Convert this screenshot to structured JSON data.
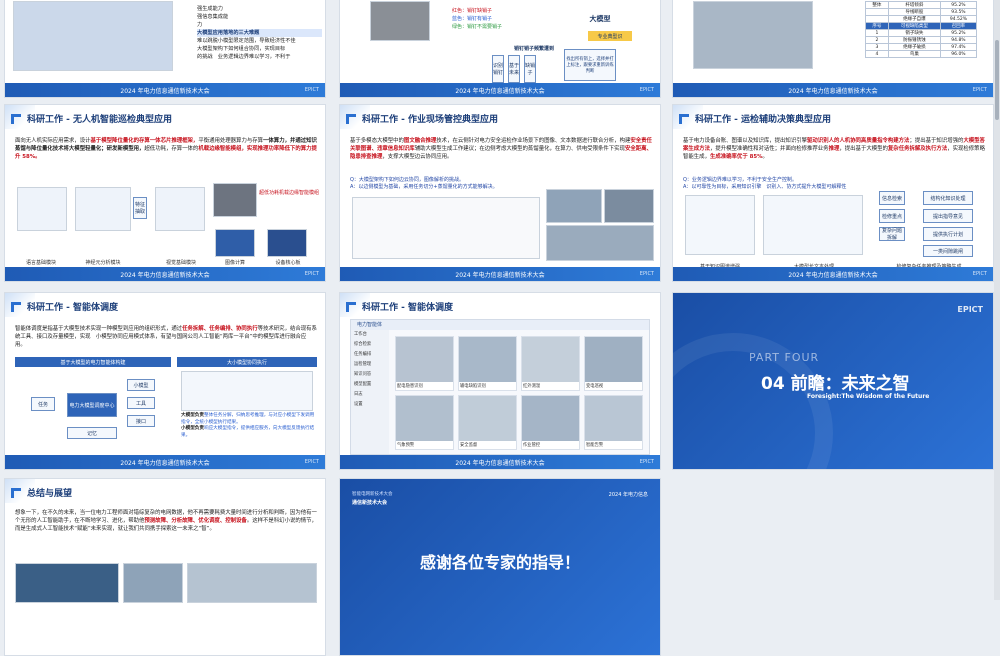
{
  "footer_text": "2024 年电力信息通信新技术大会",
  "footer_logo": "EPICT",
  "s1": {
    "items": [
      "强生成能力",
      "强信息集成能",
      "力",
      "大模型应用落地的三大难题",
      "难以跳脱小模型限定范围，导致经济性不佳",
      "大模型架构下如何组合协同，实现目标",
      "的挑战　业务逻辑边界难以学习，不利于"
    ]
  },
  "s2": {
    "labels": [
      "红色：销钉缺销子",
      "蓝色：销钉有销子",
      "绿色：销钉不需要销子",
      "大模型",
      "销钉销子频繁遭到",
      "识别销钉",
      "基于未来",
      "缺销子",
      "多次训练上：选择大模型（前期是从少数样本总结经验）",
      "找出所有销上，选择并打上标注，跟要求重新训练判断",
      "销钉部分"
    ],
    "right": [
      "大模型",
      "专业典型识"
    ]
  },
  "s3": {
    "rows": [
      [
        "整体",
        "杆塔倾斜",
        "95.2%"
      ],
      [
        "",
        "导线断股",
        "93.5%"
      ],
      [
        "",
        "绝缘子自爆",
        "94.52%"
      ],
      [
        "序号",
        "可视缺陷类型",
        "召回率"
      ],
      [
        "1",
        "销子缺失",
        "95.2%"
      ],
      [
        "2",
        "防振锤锈蚀",
        "94.8%"
      ],
      [
        "3",
        "绝缘子破损",
        "97.4%"
      ],
      [
        "4",
        "鸟巢",
        "96.0%"
      ]
    ]
  },
  "s4": {
    "title": "科研工作 - 无人机智能巡检典型应用",
    "p1a": "面向无人机实际应用需求，设计",
    "p1b": "基于模型降位量化的存算一体芯片推理框架，",
    "p1c": "平衡通用处理器算力与存算",
    "p1d": "一体算力，",
    "p1e": "并通过知识蒸馏与降位量化技术将大模型轻量化；",
    "p1f": "研发新模型用，",
    "p1g": "超低功耗，存算一体的",
    "p1h": "机载边缘智能模组，实现推理功率降低下的算力提升 58%。",
    "caps": [
      "语言基础模块",
      "神经元分析模块",
      "视觉基础模块",
      "图像计算",
      "边缘智能计",
      "设备核心板"
    ],
    "boxes": [
      "特征抽取",
      "蒸馏",
      "知识",
      "超低功耗机载边缘智能模组"
    ]
  },
  "s5": {
    "title": "科研工作 - 作业现场管控典型应用",
    "p1": "基于多模态大模型中的",
    "p1r": "图文融合推理",
    "p1b": "技术，在云侧针对电力安全运检作业场景下的图像、文本数据进行联合分析，构建",
    "p1r2": "安全责任关联图谱、违章信息知识库",
    "p1c": "辅助大模型生成工作建议；在边侧考虑大模型的蒸馏量化，在算力、供电受限条件下实现",
    "p1r3": "安全距离、隐患排查推理",
    "p1d": "，支撑大模型边云协同应用。",
    "qa": [
      "Q：大模型架构下如何边云协同，图像解析的挑战。",
      "A：以边侧模型为基础，采用任务切分+蒸馏量化的方式能够解决。"
    ]
  },
  "s6": {
    "title": "科研工作 - 运检辅助决策典型应用",
    "p1": "基于电力设备台账、图谱以及知识库，提出知识引擎",
    "p1b": "驱动",
    "p1r": "识别人的人机协同高质量指令构建方法",
    "p1c": "；提出基于知识增强的",
    "p1r2": "大模型答案生成方法",
    "p1d": "，提升模型准确性和对话性；并面向检修推荐业务",
    "p1r3": "推理",
    "p1e": "，提出基于大模型的",
    "p1r4": "复杂任务拆解及执行方法",
    "p1f": "，实现检修策略智能生成，",
    "p1r5": "生成准确率优于 85%",
    "p1g": "。",
    "qa": [
      "Q：业务逻辑边界难以学习，不利于安全生产控制。",
      "A：以可靠性为目标，采用知识引擎　识别入、协方式提升大模型可解释性"
    ],
    "caps": [
      "基于知识图谱增强",
      "大模型长文本处理",
      "检修复杂任务推理及策略生成"
    ],
    "right": [
      "信息检索",
      "结构化知识处理",
      "检修重点",
      "提出指导意见",
      "复杂问题拆解",
      "提供执行计划",
      "一类间隙跳闸"
    ]
  },
  "s7": {
    "title": "科研工作 - 智能体调度",
    "p1": "智能体调度是指基于大模型技术实现一种模型到应用的组织形式，通过",
    "p1r": "任务拆解、任务编排、协同执行",
    "p1b": "等技术研究，结合现有系统工具、接口及存量模型，实现　小模型协同应用模式体系，有望与国网公司人工智能“两库一平台”中的模型库进行融合应用。",
    "left_h": "基于大模型的电力智能体构建",
    "right_h": "大小模型协同执行",
    "boxes": [
      "电力大模型调度中心",
      "任务",
      "小模型",
      "工具",
      "接口",
      "记忆"
    ],
    "right_p1": "大模型负责",
    "right_p1b": "整体任务分解，归纳思考推理，与对应小模型下发调用指令，全统小模型执行结果。",
    "right_p2": "小模型负责",
    "right_p2b": "响应大模型指令，提供相应服务，向大模型反馈执行结果。"
  },
  "s8": {
    "title": "科研工作 - 智能体调度",
    "header": "电力智能体",
    "menu": [
      "工作台",
      "综合检索",
      "任务编排",
      "运检管理",
      "知识问答",
      "模型配置",
      "日志",
      "设置"
    ],
    "cards": [
      "配电隐患识别",
      "输电缺陷识别",
      "红外测温",
      "变电巡视",
      "气象预警",
      "安全监督",
      "作业管控",
      "智能告警",
      "设备台账"
    ]
  },
  "s9": {
    "part": "PART FOUR",
    "heading": "04 前瞻：未来之智",
    "sub": "Foresight:The Wisdom of the Future",
    "logo": "EPICT"
  },
  "s10": {
    "title": "总结与展望",
    "p1": "想象一下，在不久的未来，当一位电力工程师面对错综复杂的电网数据，他不再需要耗费大量时间进行分析和判断，因为他有一个无形的人工智能助手，在不断地学习、进化，帮助他",
    "p1r": "预测故障、分析故障、优化调度、控制设备",
    "p1b": "。这样不是科幻小说的情节，而是生成式人工智能技术“赋能”未来实现，就让我们共同携手探索这一未来之“智”。"
  },
  "s11": {
    "top_left": "智能电网新技术大会",
    "top_right": "2024 年电力信息",
    "sub_left": "通信新技术大会",
    "main": "感谢各位专家的指导！"
  }
}
